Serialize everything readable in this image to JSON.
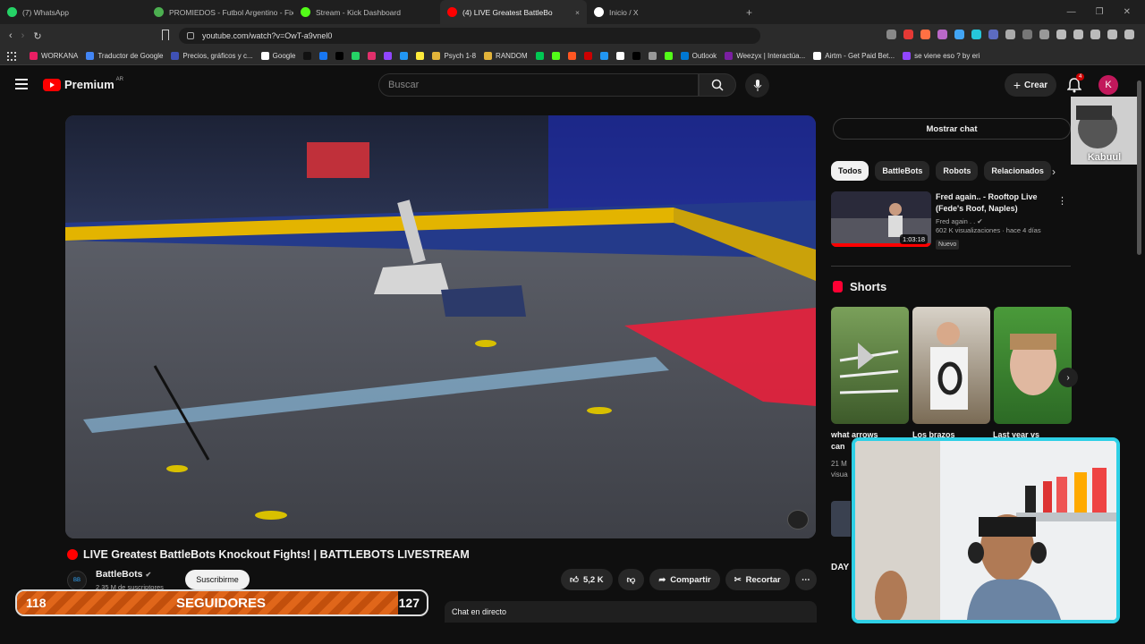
{
  "browser": {
    "tabs": [
      {
        "label": "(7) WhatsApp",
        "color": "#25d366"
      },
      {
        "label": "PROMIEDOS - Futbol Argentino - Fix",
        "color": "#4caf50"
      },
      {
        "label": "Stream - Kick Dashboard",
        "color": "#53fc18"
      },
      {
        "label": "(4)  LIVE Greatest BattleBo",
        "color": "#ff0000"
      },
      {
        "label": "Inicio / X",
        "color": "#ffffff"
      }
    ],
    "url": "youtube.com/watch?v=OwT-a9vnel0",
    "bookmarks": [
      {
        "label": "WORKANA",
        "color": "#e91e63"
      },
      {
        "label": "Traductor de Google",
        "color": "#4285f4"
      },
      {
        "label": "Precios, gráficos y c...",
        "color": "#3f51b5"
      },
      {
        "label": "Google",
        "color": "#ffffff"
      },
      {
        "label": "",
        "color": "#111111"
      },
      {
        "label": "",
        "color": "#1877f2"
      },
      {
        "label": "",
        "color": "#000000"
      },
      {
        "label": "",
        "color": "#25d366"
      },
      {
        "label": "",
        "color": "#e1306c"
      },
      {
        "label": "",
        "color": "#9146ff"
      },
      {
        "label": "",
        "color": "#2196f3"
      },
      {
        "label": "",
        "color": "#ffeb3b"
      },
      {
        "label": "Psych 1-8",
        "color": "#e2b33a"
      },
      {
        "label": "RANDOM",
        "color": "#e2b33a"
      },
      {
        "label": "",
        "color": "#00c853"
      },
      {
        "label": "",
        "color": "#53fc18"
      },
      {
        "label": "",
        "color": "#ff5722"
      },
      {
        "label": "",
        "color": "#cc0000"
      },
      {
        "label": "",
        "color": "#2196f3"
      },
      {
        "label": "",
        "color": "#ffffff"
      },
      {
        "label": "",
        "color": "#000000"
      },
      {
        "label": "",
        "color": "#999999"
      },
      {
        "label": "",
        "color": "#53fc18"
      },
      {
        "label": "Outlook",
        "color": "#0078d4"
      },
      {
        "label": "Weezyx | Interactúa...",
        "color": "#7b1fa2"
      },
      {
        "label": "Airtm - Get Paid Bet...",
        "color": "#ffffff"
      },
      {
        "label": "se viene eso ? by eri",
        "color": "#9146ff"
      }
    ]
  },
  "header": {
    "logo_text": "Premium",
    "region": "AR",
    "search_placeholder": "Buscar",
    "create_label": "Crear",
    "notification_count": "4",
    "avatar_letter": "K"
  },
  "video": {
    "title": "LIVE Greatest BattleBots Knockout Fights! | BATTLEBOTS LIVESTREAM",
    "channel": "BattleBots",
    "subscribers": "2,35 M de suscriptores",
    "subscribe_label": "Suscribirme",
    "likes": "5,2 K",
    "share_label": "Compartir",
    "clip_label": "Recortar",
    "live_chat_label": "Chat en directo"
  },
  "overlay": {
    "followers_current": "118",
    "followers_label": "SEGUIDORES",
    "followers_goal": "127",
    "progress": 0.93,
    "webcam_name": "Kabuul"
  },
  "sidebar": {
    "show_chat": "Mostrar chat",
    "chips": [
      "Todos",
      "BattleBots",
      "Robots",
      "Relacionados"
    ],
    "rec": {
      "title": "Fred again.. - Rooftop Live (Fede's Roof, Naples)",
      "channel": "Fred again . .",
      "meta": "602 K visualizaciones · hace 4 días",
      "badge": "Nuevo",
      "duration": "1:03:18"
    },
    "shorts_title": "Shorts",
    "shorts": [
      {
        "title": "what arrows can",
        "meta": "21 M",
        "meta2": "visua"
      },
      {
        "title": "Los brazos",
        "meta": "",
        "meta2": ""
      },
      {
        "title": "Last year vs",
        "meta": "",
        "meta2": ""
      }
    ],
    "fragment": "DAY"
  }
}
